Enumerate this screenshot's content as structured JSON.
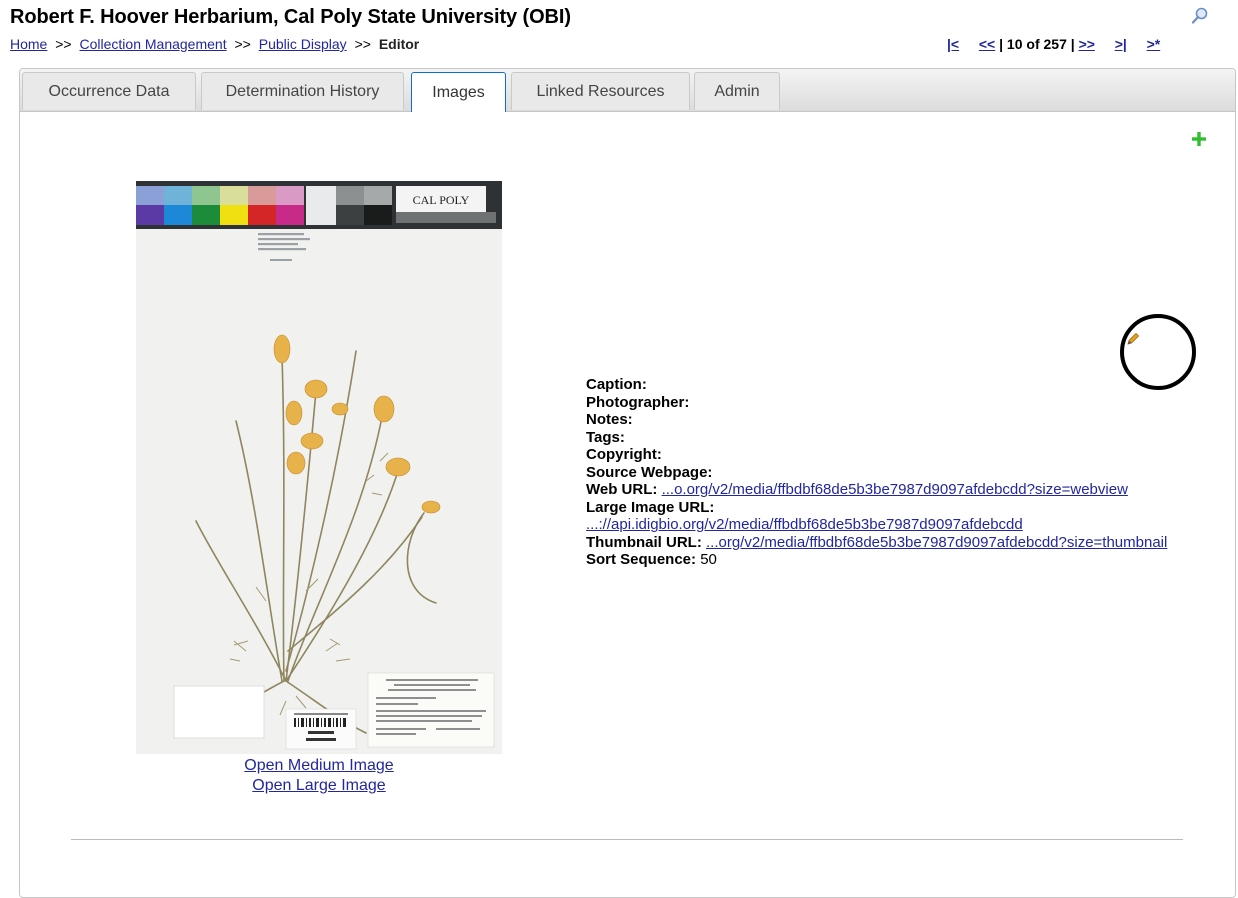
{
  "page": {
    "title": "Robert F. Hoover Herbarium, Cal Poly State University (OBI)"
  },
  "breadcrumb": {
    "home": "Home",
    "sep1": ">>",
    "collection_management": "Collection Management",
    "sep2": ">>",
    "public_display": "Public Display",
    "sep3": ">>",
    "current": "Editor"
  },
  "pager": {
    "first": "|<",
    "prev": "<<",
    "position": "| 10 of 257 |",
    "next": ">>",
    "last": ">|",
    "new": ">*"
  },
  "tabs": [
    {
      "label": "Occurrence Data"
    },
    {
      "label": "Determination History"
    },
    {
      "label": "Images"
    },
    {
      "label": "Linked Resources"
    },
    {
      "label": "Admin"
    }
  ],
  "active_tab": "Images",
  "specimen_image": {
    "brand_label": "CAL POLY",
    "links": {
      "medium": "Open Medium Image",
      "large": "Open Large Image"
    }
  },
  "image_fields": {
    "caption_label": "Caption:",
    "photographer_label": "Photographer:",
    "notes_label": "Notes:",
    "tags_label": "Tags:",
    "copyright_label": "Copyright:",
    "source_webpage_label": "Source Webpage:",
    "web_url_label": "Web URL:",
    "web_url_value": "...o.org/v2/media/ffbdbf68de5b3be7987d9097afdebcdd?size=webview",
    "large_image_url_label": "Large Image URL:",
    "large_image_url_value": "...://api.idigbio.org/v2/media/ffbdbf68de5b3be7987d9097afdebcdd",
    "thumbnail_url_label": "Thumbnail URL:",
    "thumbnail_url_value": "...org/v2/media/ffbdbf68de5b3be7987d9097afdebcdd?size=thumbnail",
    "sort_sequence_label": "Sort Sequence:",
    "sort_sequence_value": "50"
  },
  "icons": {
    "search": "search-icon",
    "add": "plus-icon",
    "edit": "pencil-icon"
  },
  "colors": {
    "link": "#21279e",
    "active_tab_border": "#0f6dd6",
    "add_icon": "#2fbf2f",
    "edit_icon": "#e8a21a",
    "highlight_ring": "#000000"
  }
}
